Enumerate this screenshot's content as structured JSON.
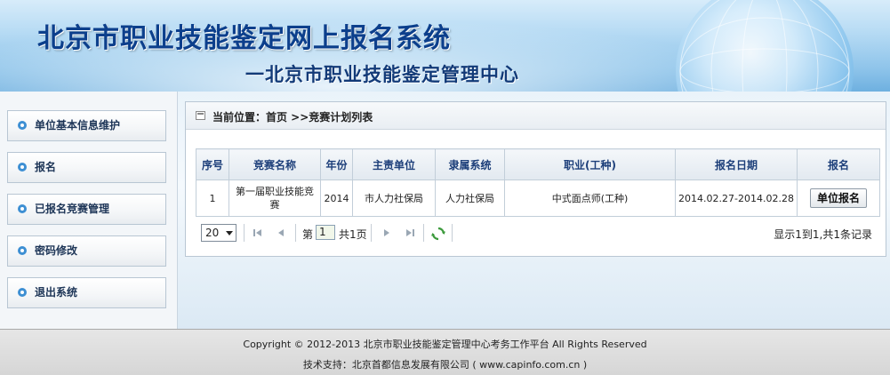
{
  "header": {
    "title": "北京市职业技能鉴定网上报名系统",
    "subtitle": "一北京市职业技能鉴定管理中心"
  },
  "sidebar": {
    "items": [
      {
        "label": "单位基本信息维护"
      },
      {
        "label": "报名"
      },
      {
        "label": "已报名竞赛管理"
      },
      {
        "label": "密码修改"
      },
      {
        "label": "退出系统"
      }
    ]
  },
  "breadcrumb": {
    "text": "当前位置：首页 >>竞赛计划列表"
  },
  "table": {
    "headers": [
      "序号",
      "竞赛名称",
      "年份",
      "主责单位",
      "隶属系统",
      "职业(工种)",
      "报名日期",
      "报名"
    ],
    "rows": [
      {
        "index": "1",
        "name": "第一届职业技能竞赛",
        "year": "2014",
        "unit": "市人力社保局",
        "system": "人力社保局",
        "occupation": "中式面点师(工种)",
        "date": "2014.02.27-2014.02.28",
        "action": "单位报名"
      }
    ]
  },
  "pager": {
    "page_size": "20",
    "page_prefix": "第",
    "current_page": "1",
    "page_suffix": "共1页",
    "info": "显示1到1,共1条记录"
  },
  "footer": {
    "copyright": "Copyright © 2012-2013 北京市职业技能鉴定管理中心考务工作平台 All Rights Reserved",
    "support": "技术支持：北京首都信息发展有限公司 ( www.capinfo.com.cn )"
  }
}
